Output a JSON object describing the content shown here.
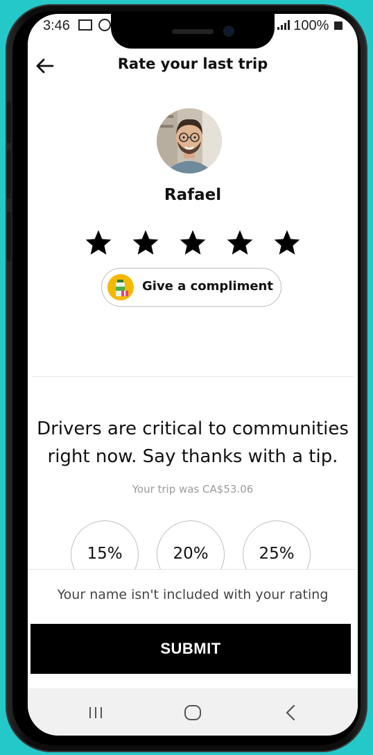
{
  "status_bar": {
    "time": "3:46",
    "battery": "100%"
  },
  "header": {
    "title": "Rate your last trip"
  },
  "driver": {
    "name": "Rafael"
  },
  "rating": {
    "stars": 5,
    "max": 5
  },
  "compliment": {
    "label": "Give a compliment"
  },
  "tip": {
    "message_line1": "Drivers are critical to communities",
    "message_line2": "right now. Say thanks with a tip.",
    "trip_cost": "Your trip was CA$53.06",
    "options": [
      "15%",
      "20%",
      "25%"
    ]
  },
  "footer": {
    "privacy_note": "Your name isn't included with your rating",
    "submit_label": "SUBMIT"
  },
  "colors": {
    "background": "#25c8c9",
    "submit": "#000000",
    "star": "#000000",
    "compliment_badge": "#f5b800"
  },
  "icons": [
    "back-arrow-icon",
    "star-icon",
    "gift-icon",
    "recent-apps-icon",
    "home-icon",
    "back-icon"
  ]
}
